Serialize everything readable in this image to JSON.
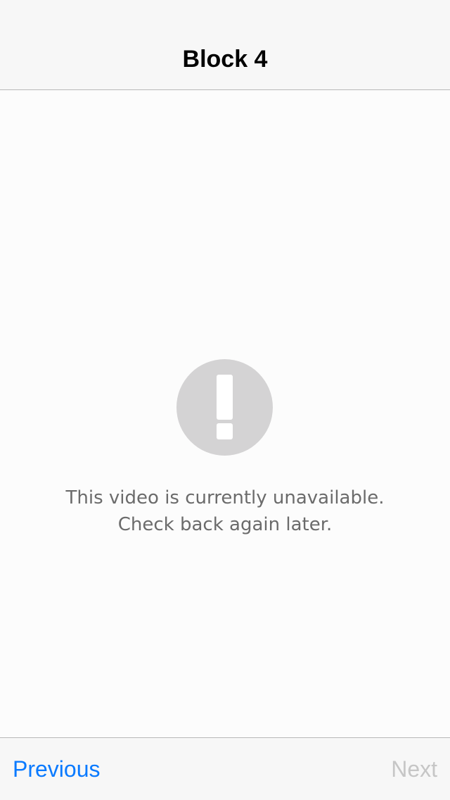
{
  "nav": {
    "title": "Block 4"
  },
  "main": {
    "icon": "exclamation-circle-icon",
    "icon_color": "#d4d3d4",
    "message_line1": "This video is currently unavailable.",
    "message_line2": "Check back again later."
  },
  "toolbar": {
    "previous_label": "Previous",
    "next_label": "Next",
    "previous_color": "#0a7aff",
    "next_color": "#c6c6c6"
  }
}
